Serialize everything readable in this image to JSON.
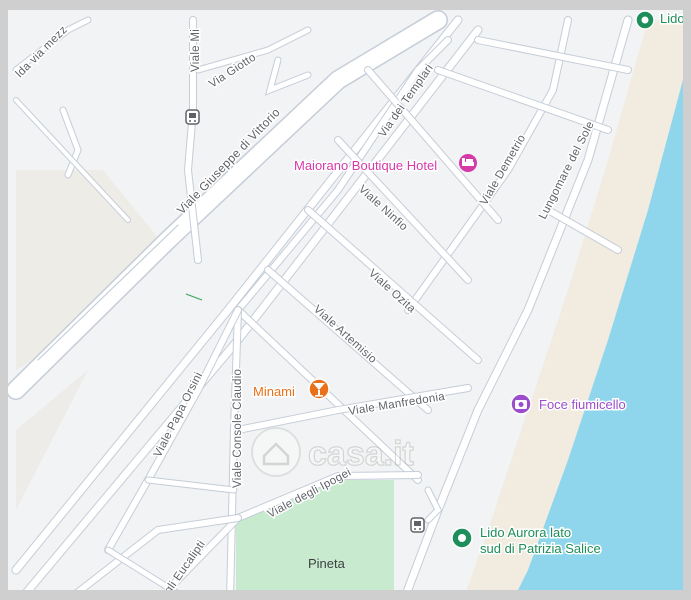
{
  "colors": {
    "land": "#f1f3f4",
    "beach": "#f1ecdf",
    "sea": "#8fd6ec",
    "park": "#c8ebcf",
    "road": "#ffffff",
    "hotel": "#d63aa8",
    "bar": "#e8711a",
    "photo": "#9c4dcc",
    "lido": "#1e8e5a"
  },
  "streets": {
    "viale_mezzo": "lda via mezz",
    "viale_mi": "Viale Mi",
    "via_giotto": "Via Giotto",
    "viale_giuseppe_di_vittorio": "Viale Giuseppe di Vittorio",
    "via_dei_templari": "Via dei Templari",
    "viale_ninfio": "Viale Ninfio",
    "viale_demetrio": "Viale Demetrio",
    "lungomare_del_sole": "Lungomare del Sole",
    "viale_ozita": "Viale Ozita",
    "viale_artemisio": "Viale Artemisio",
    "viale_manfredonia": "Viale Manfredonia",
    "viale_papa_orsini": "Viale Papa Orsini",
    "viale_console_claudio": "Viale Console Claudio",
    "viale_degli_ipogei": "Viale degli Ipogei",
    "viale_degli_eucalipti": "egli Eucalipti"
  },
  "pois": {
    "hotel": "Maiorano Boutique Hotel",
    "bar": "Minami",
    "foce": "Foce fiumicello",
    "lido_line1": "Lido Aurora lato",
    "lido_line2": "sud di Patrizia Salice",
    "top_right": "Lido"
  },
  "areas": {
    "pineta": "Pineta"
  },
  "watermark": "casa.it",
  "icons": {
    "hotel": "bed-icon",
    "bar": "cocktail-icon",
    "foce": "camera-icon",
    "lido": "place-dot-icon",
    "bus": "bus-stop-icon"
  }
}
